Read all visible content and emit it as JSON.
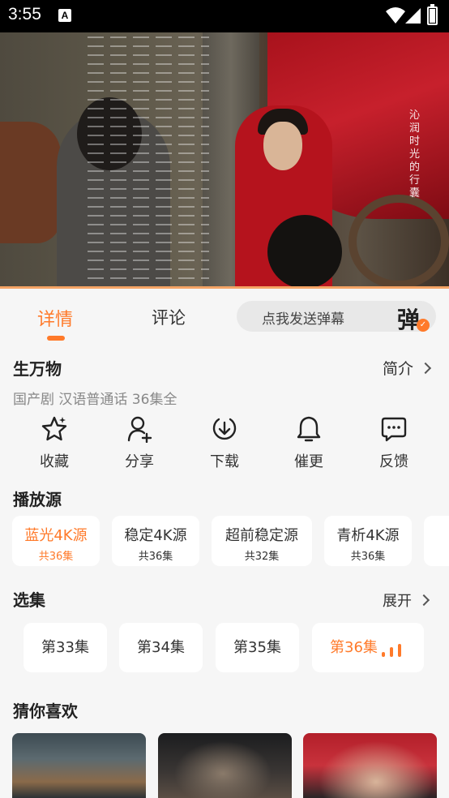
{
  "status_bar": {
    "time": "3:55",
    "notification_icon": "A"
  },
  "video": {
    "vertical_text": "沁润时光的行囊",
    "progress_fraction": 1.0
  },
  "tabs": [
    {
      "label": "详情",
      "active": true
    },
    {
      "label": "评论",
      "active": false
    }
  ],
  "danmu": {
    "placeholder": "点我发送弹幕",
    "glyph": "弹",
    "check": "✓"
  },
  "show": {
    "title": "生万物",
    "intro_label": "简介",
    "meta": "国产剧 汉语普通话 36集全"
  },
  "actions": [
    {
      "label": "收藏",
      "icon": "star-icon"
    },
    {
      "label": "分享",
      "icon": "add-person-icon"
    },
    {
      "label": "下载",
      "icon": "download-icon"
    },
    {
      "label": "催更",
      "icon": "bell-icon"
    },
    {
      "label": "反馈",
      "icon": "feedback-chat-icon"
    }
  ],
  "sources": {
    "heading": "播放源",
    "items": [
      {
        "name": "蓝光4K源",
        "count": "共36集",
        "selected": true
      },
      {
        "name": "稳定4K源",
        "count": "共36集",
        "selected": false
      },
      {
        "name": "超前稳定源",
        "count": "共32集",
        "selected": false
      },
      {
        "name": "青析4K源",
        "count": "共36集",
        "selected": false
      }
    ]
  },
  "episodes": {
    "heading": "选集",
    "expand_label": "展开",
    "items": [
      {
        "label": "第33集",
        "current": false
      },
      {
        "label": "第34集",
        "current": false
      },
      {
        "label": "第35集",
        "current": false
      },
      {
        "label": "第36集",
        "current": true
      }
    ]
  },
  "recommendations": {
    "heading": "猜你喜欢"
  },
  "colors": {
    "accent": "#ff7a2a",
    "background": "#f6f6f6",
    "card": "#ffffff"
  }
}
